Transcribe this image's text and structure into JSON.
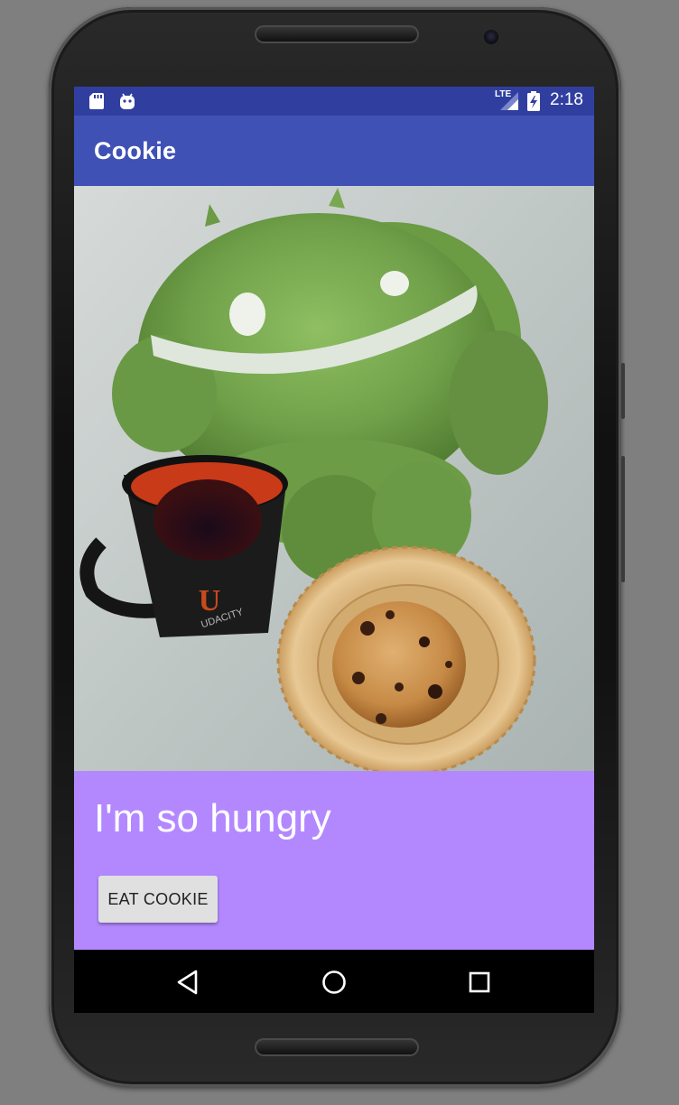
{
  "status_bar": {
    "time": "2:18",
    "network": "LTE",
    "left_icons": [
      "sd-card-icon",
      "android-icon"
    ],
    "right_icons": [
      "lte-signal-icon",
      "battery-charging-icon"
    ],
    "background": "#303f9f"
  },
  "app_bar": {
    "title": "Cookie",
    "background": "#3f51b5"
  },
  "photo": {
    "mug_text": "UDACITY",
    "mug_logo": "U"
  },
  "content": {
    "status_text": "I'm so hungry",
    "button_label": "EAT COOKIE",
    "background": "#b388ff"
  },
  "nav_bar": {
    "buttons": [
      "back-icon",
      "home-icon",
      "recents-icon"
    ]
  }
}
